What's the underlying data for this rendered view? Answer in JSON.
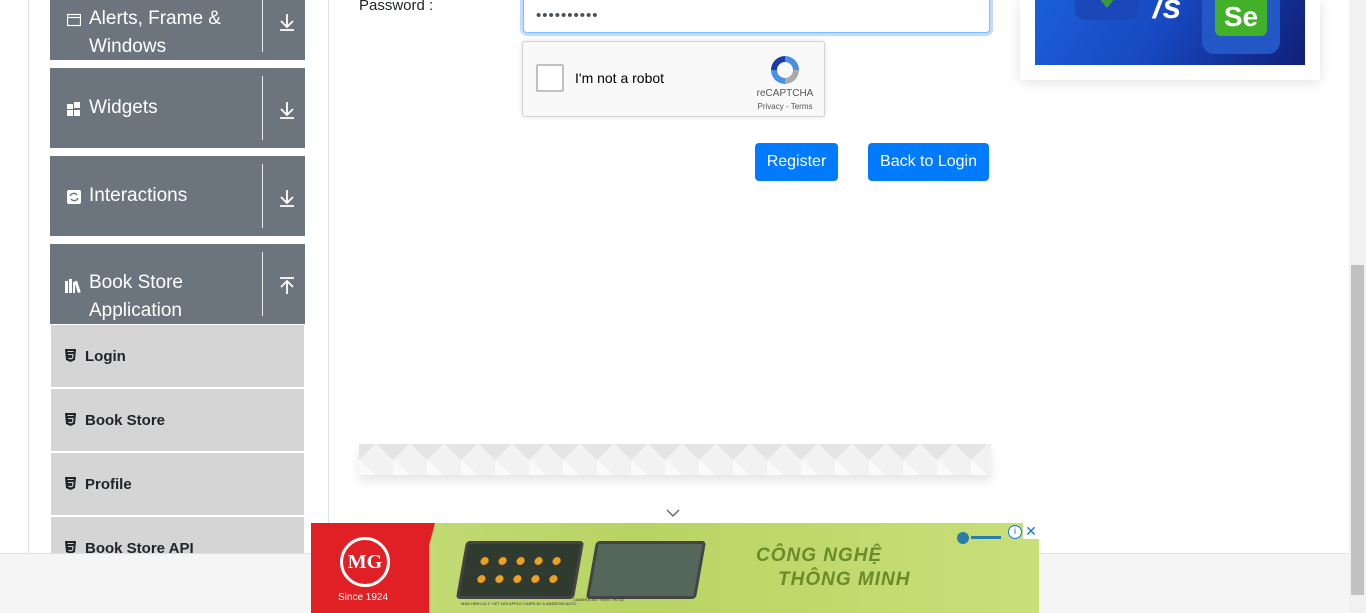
{
  "sidebar": {
    "groups": [
      {
        "title": "Alerts, Frame & Windows",
        "icon": "window-icon",
        "state": "collapsed"
      },
      {
        "title": "Widgets",
        "icon": "widgets-icon",
        "state": "collapsed"
      },
      {
        "title": "Interactions",
        "icon": "interactions-icon",
        "state": "collapsed"
      },
      {
        "title": "Book Store Application",
        "icon": "books-icon",
        "state": "expanded"
      }
    ],
    "items": [
      {
        "label": "Login"
      },
      {
        "label": "Book Store"
      },
      {
        "label": "Profile"
      },
      {
        "label": "Book Store API"
      }
    ]
  },
  "form": {
    "password_label": "Password :",
    "password_value": "••••••••••",
    "recaptcha": {
      "checkbox_label": "I'm not a robot",
      "brand": "reCAPTCHA",
      "links": "Privacy - Terms"
    },
    "register_label": "Register",
    "back_label": "Back to Login"
  },
  "side_ad": {
    "slash_text": "/s",
    "logo_text": "Se"
  },
  "banner": {
    "brand": "MG",
    "since": "Since 1924",
    "tagline_1": "CÔNG NGHỆ",
    "tagline_2": "THÔNG MINH",
    "caption_1": "MÀN HÌNH 10.1\" KẾT NỐI APPLE CARPLAY & ANDROID AUTO",
    "caption_2": "CAMERA 360° HIỂN THỊ 3D",
    "info_symbol": "i",
    "close_symbol": "✕"
  },
  "colors": {
    "sidebar_header": "#6c757d",
    "sub_item": "#d5d5d5",
    "primary": "#007bff",
    "mg_red": "#e02024"
  }
}
